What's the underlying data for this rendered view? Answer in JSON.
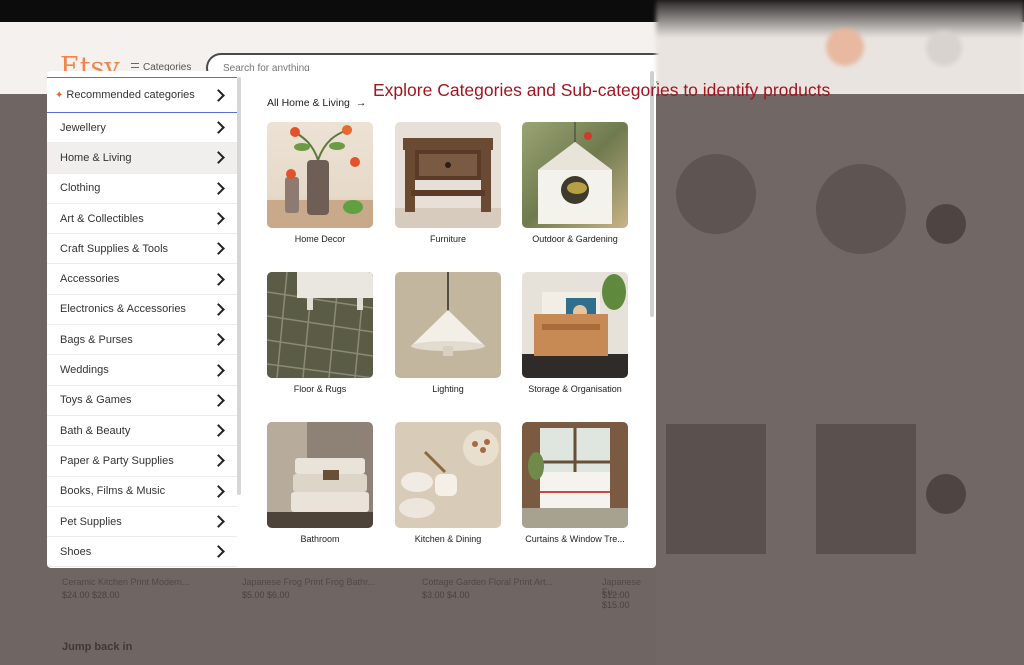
{
  "header": {
    "logo": "Etsy",
    "categories_label": "Categories",
    "search_placeholder": "Search for anything"
  },
  "annotation": "Explore Categories and Sub-categories to identify products",
  "sidebar": {
    "items": [
      {
        "label": "Recommended categories",
        "icon": "sparkle-icon"
      },
      {
        "label": "Jewellery"
      },
      {
        "label": "Home & Living"
      },
      {
        "label": "Clothing"
      },
      {
        "label": "Art & Collectibles"
      },
      {
        "label": "Craft Supplies & Tools"
      },
      {
        "label": "Accessories"
      },
      {
        "label": "Electronics & Accessories"
      },
      {
        "label": "Bags & Purses"
      },
      {
        "label": "Weddings"
      },
      {
        "label": "Toys & Games"
      },
      {
        "label": "Bath & Beauty"
      },
      {
        "label": "Paper & Party Supplies"
      },
      {
        "label": "Books, Films & Music"
      },
      {
        "label": "Pet Supplies"
      },
      {
        "label": "Shoes"
      }
    ]
  },
  "main": {
    "all_link": "All Home & Living",
    "arrow": "→",
    "subcategories": [
      {
        "label": "Home Decor"
      },
      {
        "label": "Furniture"
      },
      {
        "label": "Outdoor & Gardening"
      },
      {
        "label": "Floor & Rugs"
      },
      {
        "label": "Lighting"
      },
      {
        "label": "Storage & Organisation"
      },
      {
        "label": "Bathroom"
      },
      {
        "label": "Kitchen & Dining"
      },
      {
        "label": "Curtains & Window Tre..."
      }
    ]
  },
  "background": {
    "items": [
      {
        "title": "Ceramic Kitchen Print Modern...",
        "price": "$24.00 $28.00"
      },
      {
        "title": "Japanese Frog Print Frog Bathr...",
        "price": "$5.00 $6.00"
      },
      {
        "title": "Cottage Garden Floral Print Art...",
        "price": "$3.00 $4.00"
      },
      {
        "title": "Japanese Fu...",
        "price": "$12.00 $15.00"
      }
    ],
    "jump_back": "Jump back in"
  },
  "colors": {
    "accent": "#f1641e",
    "annotation": "#a5141e",
    "selected_border": "#5b6ed6"
  }
}
